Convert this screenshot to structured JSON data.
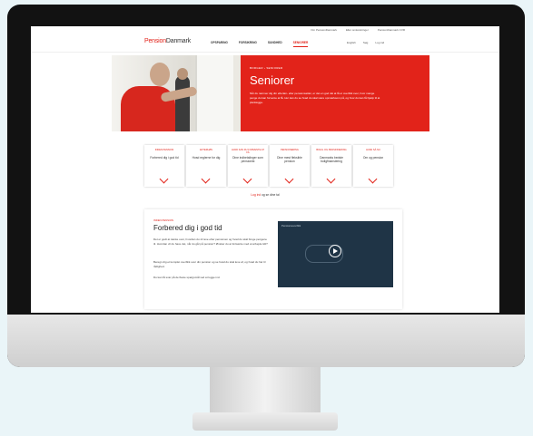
{
  "utility_links": [
    "Om PensionDanmark",
    "Eller omkostninger",
    "PensionDanmark CVR"
  ],
  "logo": {
    "brand_red": "Pension",
    "brand_dark": "Danmark"
  },
  "nav": [
    "OPSPARING",
    "FORSIKRING",
    "SUNDHED",
    "SENIORER"
  ],
  "nav_active": "SENIORER",
  "nav_right": [
    "English",
    "Søg",
    "Log ind"
  ],
  "hero": {
    "breadcrumb": "BORGER › SENIORER",
    "title": "Seniorer",
    "description": "Når du nærmer dig din efterløn- eller pensionsalder, er det en god idé at få et overblik over, hvor mange penge du kan forvente at få. Her kan du se hvad du skal være opmærksom på, og hvor du kan få hjælp til at planlægge."
  },
  "cards": [
    {
      "category": "Inden pension",
      "title": "Forbered dig i god tid"
    },
    {
      "category": "Efterløn",
      "title": "Hvad reglerne for dig"
    },
    {
      "category": "Hvad kan du forvente at få",
      "title": "Dine indbetalinger som pensionist"
    },
    {
      "category": "Pensionering",
      "title": "Dine mest fleksible pension"
    },
    {
      "category": "Bolig og pensionering",
      "title": "Danmarks bedste boligfinansiering"
    },
    {
      "category": "Hvad så nu",
      "title": "Om og pension"
    }
  ],
  "login": {
    "link": "Log ind",
    "rest": "og se dine tal"
  },
  "info": {
    "category": "Inden pension",
    "title": "Forbered dig i god tid",
    "paragraphs": [
      "Det er godt at tænke over, hvordan du vil leve efter pensionen og hvad du skal bruge pengene til. Hvordan vil du have det, når du går på pension? Ønsker du at fortsætte med at arbejde lidt?",
      "Beregn dig et komplet overblik over din pension og se hvad du skal leve af, og hvad du har til rådighed.",
      "Du kan få svar på de fleste spørgsmål ved at logge ind."
    ],
    "video_title": "Pensionsoverblik"
  },
  "colors": {
    "brand": "#e2231a",
    "video_bg": "#1f3446"
  }
}
